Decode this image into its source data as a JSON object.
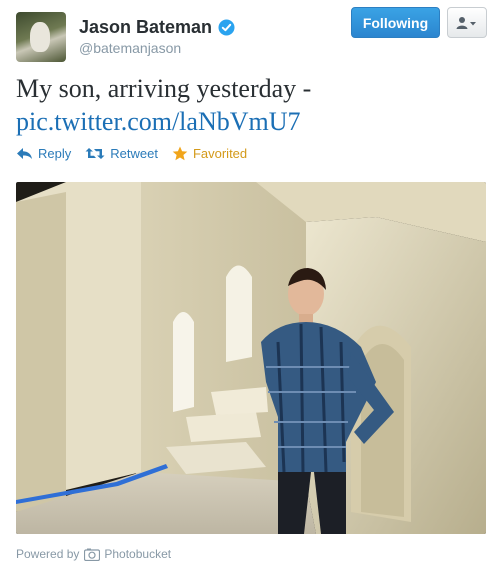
{
  "user": {
    "name": "Jason Bateman",
    "handle": "@batemanjason",
    "verified": true
  },
  "header_buttons": {
    "follow_label": "Following",
    "user_menu_icon": "user-dropdown-icon"
  },
  "tweet": {
    "text": "My son, arriving yesterday -",
    "link": "pic.twitter.com/laNbVmU7"
  },
  "actions": {
    "reply_label": "Reply",
    "retweet_label": "Retweet",
    "favorite_label": "Favorited"
  },
  "footer": {
    "powered_by_label": "Powered by",
    "provider_label": "Photobucket"
  },
  "colors": {
    "accent": "#2b7bb9",
    "favorite": "#d49a1a",
    "follow_button": "#2b85cf"
  }
}
